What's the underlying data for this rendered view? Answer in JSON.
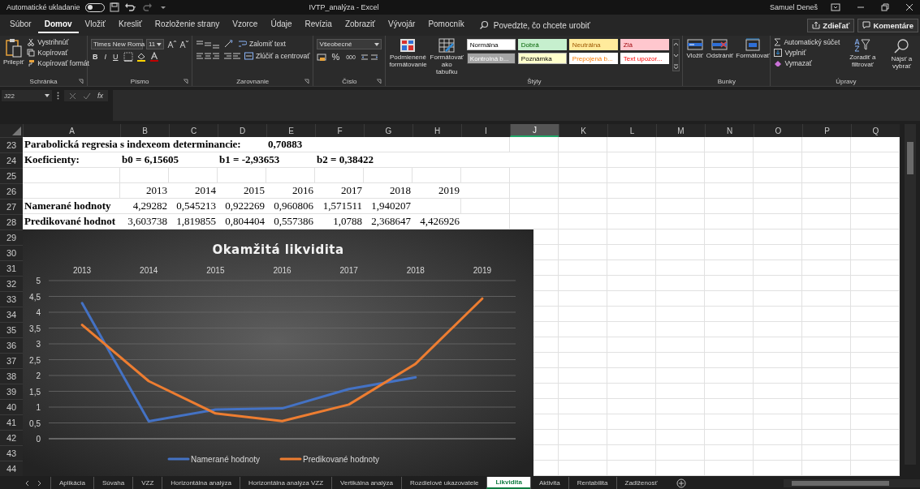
{
  "title_bar": {
    "autosave_label": "Automatické ukladanie",
    "autosave_on": false,
    "document_title": "IVTP_analýza - Excel",
    "user": "Samuel Deneš"
  },
  "menu": {
    "tabs": [
      {
        "label": "Súbor",
        "selected": false
      },
      {
        "label": "Domov",
        "selected": true
      },
      {
        "label": "Vložiť",
        "selected": false
      },
      {
        "label": "Kresliť",
        "selected": false
      },
      {
        "label": "Rozloženie strany",
        "selected": false
      },
      {
        "label": "Vzorce",
        "selected": false
      },
      {
        "label": "Údaje",
        "selected": false
      },
      {
        "label": "Revízia",
        "selected": false
      },
      {
        "label": "Zobraziť",
        "selected": false
      },
      {
        "label": "Vývojár",
        "selected": false
      },
      {
        "label": "Pomocník",
        "selected": false
      }
    ],
    "search": {
      "placeholder": "Povedzte, čo chcete urobiť"
    },
    "share": "Zdieľať",
    "comments": "Komentáre"
  },
  "ribbon": {
    "clipboard": {
      "label": "Schránka",
      "launcher": true,
      "paste": "Prilepiť",
      "cut": "Vystrihnúť",
      "copy": "Kopírovať",
      "format_painter": "Kopírovať formát"
    },
    "font": {
      "label": "Písmo",
      "launcher": true,
      "family": "Times New Roma",
      "size": "11",
      "styles": [
        "B",
        "I",
        "U"
      ]
    },
    "alignment": {
      "label": "Zarovnanie",
      "launcher": true,
      "wrap": "Zalomiť text",
      "merge": "Zlúčiť a centrovať"
    },
    "number": {
      "label": "Číslo",
      "launcher": true,
      "format": "Všeobecné",
      "percent": "%",
      "thousands": "000"
    },
    "styles": {
      "label": "Štýly",
      "conditional": "Podmienené formátovanie",
      "as_table": "Formátovať ako tabuľku",
      "items": [
        {
          "label": "Normálna",
          "kind": "normal"
        },
        {
          "label": "Dobrá",
          "kind": "good"
        },
        {
          "label": "Neutrálna",
          "kind": "neutral"
        },
        {
          "label": "Zlá",
          "kind": "bad"
        },
        {
          "label": "Kontrolná b...",
          "kind": "check"
        },
        {
          "label": "Poznámka",
          "kind": "note"
        },
        {
          "label": "Prepojená b...",
          "kind": "linked"
        },
        {
          "label": "Text upozor...",
          "kind": "warning"
        }
      ]
    },
    "cells": {
      "label": "Bunky",
      "buttons": [
        {
          "label": "Vložiť",
          "kind": "insert"
        },
        {
          "label": "Odstrániť",
          "kind": "delete"
        },
        {
          "label": "Formátovať",
          "kind": "format"
        }
      ]
    },
    "editing": {
      "label": "Úpravy",
      "autosum": "Automatický súčet",
      "fill": "Vyplniť",
      "clear": "Vymazať",
      "sort": "Zoradiť a filtrovať",
      "find": "Nájsť a vybrať"
    }
  },
  "formula_bar": {
    "name_box": "J22",
    "function_label": "fx"
  },
  "columns": [
    {
      "label": "A",
      "selected": false
    },
    {
      "label": "B",
      "selected": false
    },
    {
      "label": "C",
      "selected": false
    },
    {
      "label": "D",
      "selected": false
    },
    {
      "label": "E",
      "selected": false
    },
    {
      "label": "F",
      "selected": false
    },
    {
      "label": "G",
      "selected": false
    },
    {
      "label": "H",
      "selected": false
    },
    {
      "label": "I",
      "selected": false
    },
    {
      "label": "J",
      "selected": true
    },
    {
      "label": "K",
      "selected": false
    },
    {
      "label": "L",
      "selected": false
    },
    {
      "label": "M",
      "selected": false
    },
    {
      "label": "N",
      "selected": false
    },
    {
      "label": "O",
      "selected": false
    },
    {
      "label": "P",
      "selected": false
    },
    {
      "label": "Q",
      "selected": false
    }
  ],
  "rows": [
    {
      "label": "23",
      "cells": [
        {
          "value": "Parabolická regresia s indexeom determinancie:",
          "kind": "label"
        },
        {
          "kind": "empty"
        },
        {
          "kind": "empty"
        },
        {
          "kind": "empty"
        },
        {
          "value": "0,70883",
          "kind": "label"
        }
      ]
    },
    {
      "label": "24",
      "cells": [
        {
          "value": "Koeficienty:",
          "kind": "label"
        },
        {
          "value": "b0 = 6,15605",
          "kind": "label"
        },
        {
          "kind": "empty"
        },
        {
          "value": "b1 = -2,93653",
          "kind": "label"
        },
        {
          "kind": "empty"
        },
        {
          "value": "b2 = 0,38422",
          "kind": "label"
        }
      ]
    },
    {
      "label": "25",
      "cells": []
    },
    {
      "label": "26",
      "cells": [
        {
          "kind": "empty"
        },
        {
          "value": "2013",
          "kind": "number"
        },
        {
          "value": "2014",
          "kind": "number"
        },
        {
          "value": "2015",
          "kind": "number"
        },
        {
          "value": "2016",
          "kind": "number"
        },
        {
          "value": "2017",
          "kind": "number"
        },
        {
          "value": "2018",
          "kind": "number"
        },
        {
          "value": "2019",
          "kind": "number"
        }
      ]
    },
    {
      "label": "27",
      "cells": [
        {
          "value": "Namerané hodnoty",
          "kind": "label"
        },
        {
          "value": "4,29282",
          "kind": "number"
        },
        {
          "value": "0,545213",
          "kind": "number"
        },
        {
          "value": "0,922269",
          "kind": "number"
        },
        {
          "value": "0,960806",
          "kind": "number"
        },
        {
          "value": "1,571511",
          "kind": "number"
        },
        {
          "value": "1,940207",
          "kind": "number"
        }
      ]
    },
    {
      "label": "28",
      "cells": [
        {
          "value": "Predikované hodnot",
          "kind": "label"
        },
        {
          "value": "3,603738",
          "kind": "number"
        },
        {
          "value": "1,819855",
          "kind": "number"
        },
        {
          "value": "0,804404",
          "kind": "number"
        },
        {
          "value": "0,557386",
          "kind": "number"
        },
        {
          "value": "1,0788",
          "kind": "number"
        },
        {
          "value": "2,368647",
          "kind": "number"
        },
        {
          "value": "4,426926",
          "kind": "number"
        }
      ]
    },
    {
      "label": "29",
      "cells": []
    },
    {
      "label": "30",
      "cells": []
    },
    {
      "label": "31",
      "cells": []
    },
    {
      "label": "32",
      "cells": []
    },
    {
      "label": "33",
      "cells": []
    },
    {
      "label": "34",
      "cells": []
    },
    {
      "label": "35",
      "cells": []
    },
    {
      "label": "36",
      "cells": []
    },
    {
      "label": "37",
      "cells": []
    },
    {
      "label": "38",
      "cells": []
    },
    {
      "label": "39",
      "cells": []
    },
    {
      "label": "40",
      "cells": []
    },
    {
      "label": "41",
      "cells": []
    },
    {
      "label": "42",
      "cells": []
    },
    {
      "label": "43",
      "cells": []
    },
    {
      "label": "44",
      "cells": []
    }
  ],
  "chart": {
    "chart_data": {
      "type": "line",
      "title": "Okamžitá likvidita",
      "categories": [
        "2013",
        "2014",
        "2015",
        "2016",
        "2017",
        "2018",
        "2019"
      ],
      "series": [
        {
          "name": "Namerané hodnoty",
          "color": "#4472c4",
          "values": [
            4.29,
            0.55,
            0.92,
            0.96,
            1.57,
            1.94,
            null
          ]
        },
        {
          "name": "Predikované hodnoty",
          "color": "#ed7d31",
          "values": [
            3.6,
            1.82,
            0.8,
            0.56,
            1.08,
            2.37,
            4.43
          ]
        }
      ],
      "ylim": [
        0,
        5
      ],
      "yticks": [
        {
          "value": 0,
          "label": "0"
        },
        {
          "value": 0.5,
          "label": "0,5"
        },
        {
          "value": 1,
          "label": "1"
        },
        {
          "value": 1.5,
          "label": "1,5"
        },
        {
          "value": 2,
          "label": "2"
        },
        {
          "value": 2.5,
          "label": "2,5"
        },
        {
          "value": 3,
          "label": "3"
        },
        {
          "value": 3.5,
          "label": "3,5"
        },
        {
          "value": 4,
          "label": "4"
        },
        {
          "value": 4.5,
          "label": "4,5"
        },
        {
          "value": 5,
          "label": "5"
        }
      ],
      "grid": true,
      "legend": "bottom"
    }
  },
  "sheet_tabs": [
    {
      "label": "Aplikácia",
      "selected": false
    },
    {
      "label": "Súvaha",
      "selected": false
    },
    {
      "label": "VZZ",
      "selected": false
    },
    {
      "label": "Horizontálna analýza",
      "selected": false
    },
    {
      "label": "Horizontálna analýza VZZ",
      "selected": false
    },
    {
      "label": "Vertikálna analýza",
      "selected": false
    },
    {
      "label": "Rozdielové ukazovatele",
      "selected": false
    },
    {
      "label": "Likvidita",
      "selected": true
    },
    {
      "label": "Aktivita",
      "selected": false
    },
    {
      "label": "Rentabilita",
      "selected": false
    },
    {
      "label": "Zadlženosť",
      "selected": false
    }
  ]
}
